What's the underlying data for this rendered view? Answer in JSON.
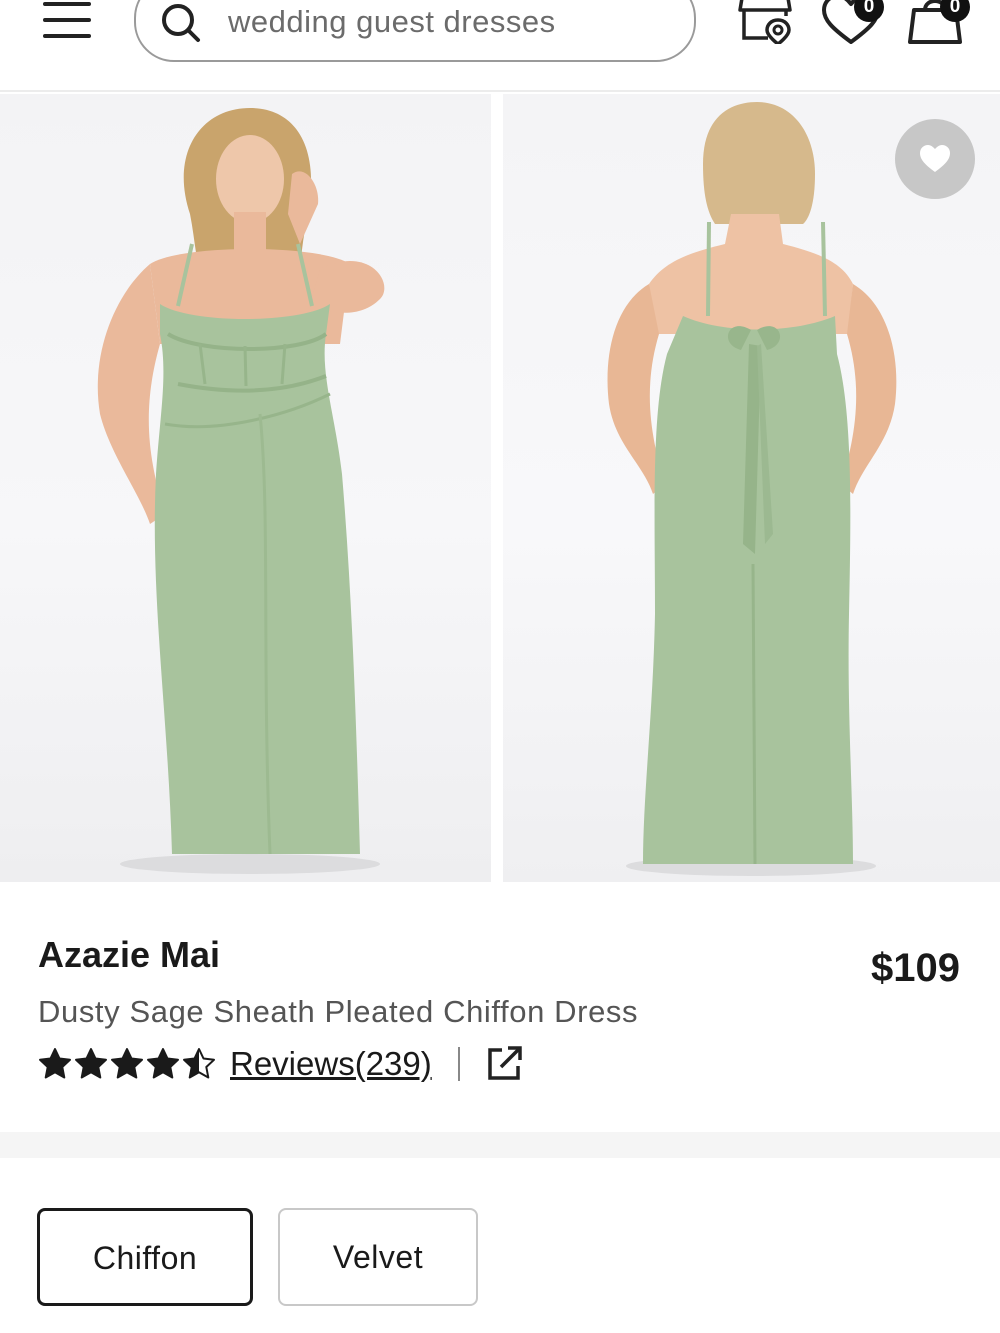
{
  "header": {
    "search": {
      "placeholder": "wedding guest dresses",
      "value": ""
    },
    "icons": {
      "menu": "menu-icon",
      "search": "search-icon",
      "store": "store-locator-icon",
      "wishlist": "heart-icon",
      "bag": "bag-icon"
    },
    "wishlist_count": "0",
    "bag_count": "0"
  },
  "gallery": {
    "images": [
      {
        "name": "front-view-photo",
        "alt": "Dress front view"
      },
      {
        "name": "back-view-photo",
        "alt": "Dress back view"
      }
    ],
    "favorite_icon": "heart-icon",
    "dress_color": "#a8c39d"
  },
  "product": {
    "brand": "Azazie Mai",
    "name": "Dusty Sage Sheath Pleated Chiffon Dress",
    "price": "$109",
    "rating": 4.5,
    "rating_max": 5,
    "reviews_label": "Reviews(239)"
  },
  "fabric_options": [
    {
      "label": "Chiffon",
      "selected": true
    },
    {
      "label": "Velvet",
      "selected": false
    }
  ],
  "colors": {
    "accent": "#1a1a1a",
    "muted_text": "#555555",
    "border": "#c8c8c8"
  }
}
